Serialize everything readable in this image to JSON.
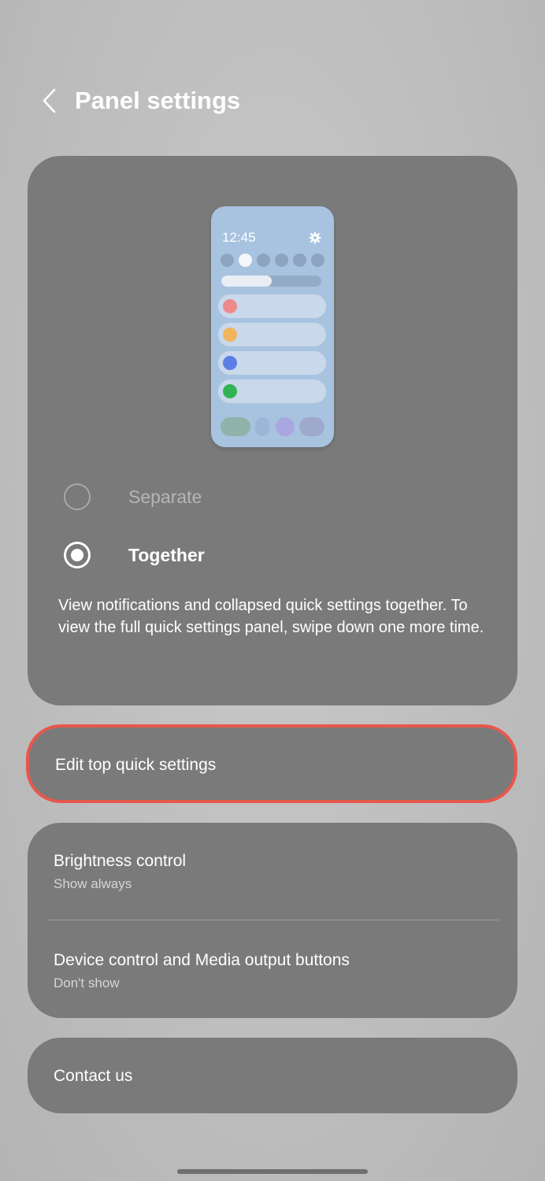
{
  "header": {
    "back_icon": "chevron-left-icon",
    "title": "Panel settings"
  },
  "preview": {
    "time": "12:45",
    "gear_icon": "gear-icon",
    "brightness_level": 0.5,
    "tile_colors": [
      "#ef8a8a",
      "#f2b45c",
      "#5b7fe6",
      "#34b356"
    ]
  },
  "layout_options": {
    "separate_label": "Separate",
    "together_label": "Together",
    "selected": "Together",
    "description": "View notifications and collapsed quick settings together. To view the full quick settings panel, swipe down one more time."
  },
  "edit_top": {
    "label": "Edit top quick settings",
    "highlight_color": "#e8574d"
  },
  "brightness": {
    "title": "Brightness control",
    "value": "Show always"
  },
  "device_control": {
    "title": "Device control and Media output buttons",
    "value": "Don't show"
  },
  "contact": {
    "label": "Contact us"
  }
}
